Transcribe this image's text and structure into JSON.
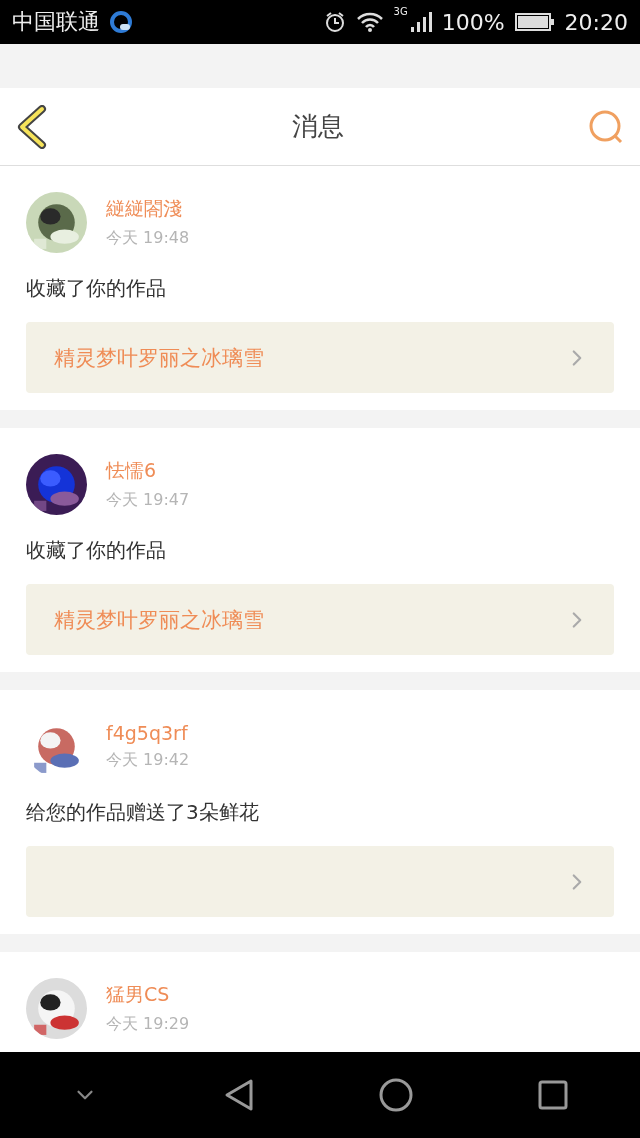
{
  "status_bar": {
    "carrier": "中国联通",
    "network": "3G",
    "battery": "100%",
    "time": "20:20"
  },
  "header": {
    "title": "消息"
  },
  "messages": [
    {
      "name": "縌縌閤淺",
      "time": "今天 19:48",
      "text": "收藏了你的作品",
      "work": "精灵梦叶罗丽之冰璃雪"
    },
    {
      "name": "怯懦6",
      "time": "今天 19:47",
      "text": "收藏了你的作品",
      "work": "精灵梦叶罗丽之冰璃雪"
    },
    {
      "name": "f4g5q3rf",
      "time": "今天 19:42",
      "text": "给您的作品赠送了3朵鲜花"
    },
    {
      "name": "猛男CS",
      "time": "今天 19:29"
    }
  ]
}
